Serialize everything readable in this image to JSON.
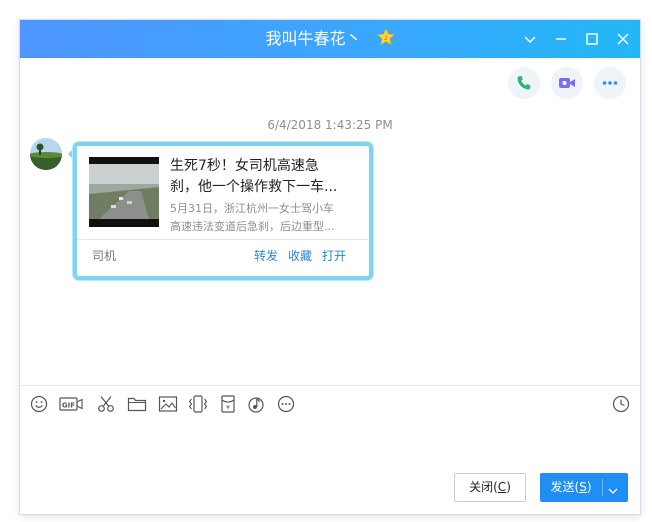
{
  "window": {
    "title": "我叫牛春花丶",
    "controls": [
      "chevron-down-icon",
      "minimize-icon",
      "maximize-icon",
      "close-icon"
    ]
  },
  "header_actions": [
    {
      "name": "voice-call-button",
      "icon": "phone-icon",
      "color": "#2bb673"
    },
    {
      "name": "video-call-button",
      "icon": "video-icon",
      "color": "#7b6cf6"
    },
    {
      "name": "more-button",
      "icon": "more-icon",
      "color": "#3a8ee6"
    }
  ],
  "chat": {
    "timestamp": "6/4/2018 1:43:25 PM",
    "message": {
      "card": {
        "title": "生死7秒！女司机高速急刹，他一个操作救下一车...",
        "title_line1": "生死7秒！女司机高速急",
        "title_line2": "刹，他一个操作救下一车...",
        "desc_line1": "5月31日，浙江杭州一女士驾小车",
        "desc_line2": "高速违法变道后急刹，后边重型...",
        "source": "司机",
        "actions": [
          "转发",
          "收藏",
          "打开"
        ]
      }
    }
  },
  "toolbar": {
    "tools": [
      "emoji-icon",
      "gif-icon",
      "scissors-icon",
      "folder-icon",
      "image-icon",
      "shake-icon",
      "red-packet-icon",
      "music-icon",
      "more-icon"
    ],
    "history_icon": "clock-icon"
  },
  "footer": {
    "close_label": "关闭(",
    "close_key": "C",
    "close_tail": ")",
    "send_label": "发送(",
    "send_key": "S",
    "send_tail": ")"
  },
  "colors": {
    "titlebar_start": "#4e95ff",
    "titlebar_end": "#22b8f5",
    "card_border": "#7fd4ef",
    "link": "#2a86d1",
    "send_button": "#1f8ff5"
  }
}
